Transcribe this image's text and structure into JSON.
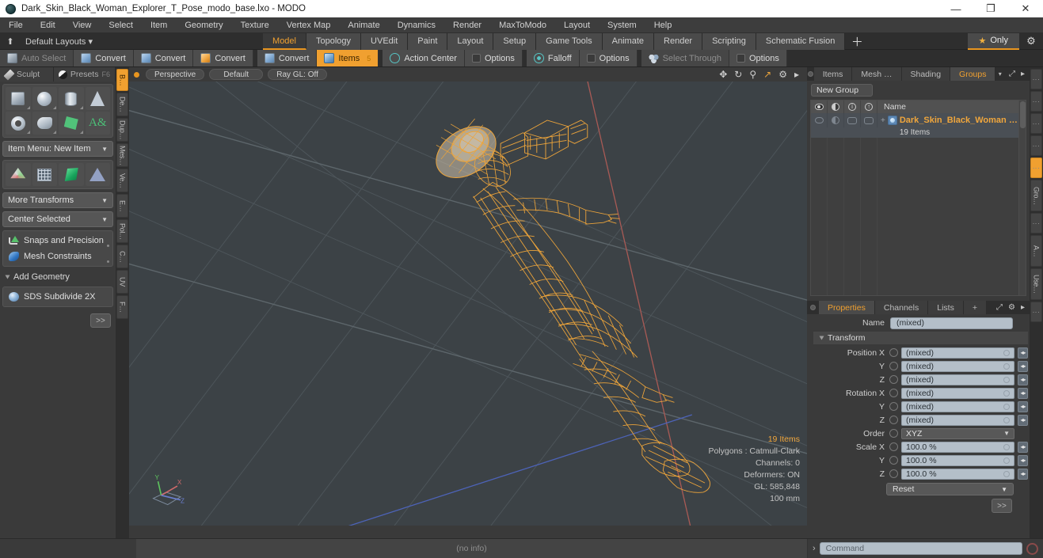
{
  "window": {
    "title": "Dark_Skin_Black_Woman_Explorer_T_Pose_modo_base.lxo - MODO",
    "minimize": "—",
    "maximize": "❐",
    "close": "✕"
  },
  "menu": {
    "items": [
      "File",
      "Edit",
      "View",
      "Select",
      "Item",
      "Geometry",
      "Texture",
      "Vertex Map",
      "Animate",
      "Dynamics",
      "Render",
      "MaxToModo",
      "Layout",
      "System",
      "Help"
    ]
  },
  "layoutbar": {
    "home_icon": "⬆",
    "layouts_label": "Default Layouts",
    "caret": "▾",
    "tabs": [
      {
        "label": "Model",
        "active": true
      },
      {
        "label": "Topology",
        "active": false
      },
      {
        "label": "UVEdit",
        "active": false
      },
      {
        "label": "Paint",
        "active": false
      },
      {
        "label": "Layout",
        "active": false
      },
      {
        "label": "Setup",
        "active": false
      },
      {
        "label": "Game Tools",
        "active": false
      },
      {
        "label": "Animate",
        "active": false
      },
      {
        "label": "Render",
        "active": false
      },
      {
        "label": "Scripting",
        "active": false
      },
      {
        "label": "Schematic Fusion",
        "active": false
      }
    ],
    "plus": "＋",
    "only_label": "Only",
    "star": "★",
    "gear": "⚙"
  },
  "modebar": {
    "auto_select": "Auto Select",
    "convert_1": "Convert",
    "convert_2": "Convert",
    "convert_3": "Convert",
    "convert_4": "Convert",
    "items": "Items",
    "items_badge": "5",
    "action_center": "Action Center",
    "options_1": "Options",
    "falloff": "Falloff",
    "options_2": "Options",
    "select_through": "Select Through",
    "options_3": "Options"
  },
  "left_panel": {
    "tabs": [
      {
        "label": "Sculpt",
        "shortcut": ""
      },
      {
        "label": "Presets",
        "shortcut": "F6"
      }
    ],
    "primitives": [
      {
        "name": "cube"
      },
      {
        "name": "sphere"
      },
      {
        "name": "cylinder"
      },
      {
        "name": "cone"
      },
      {
        "name": "torus"
      },
      {
        "name": "teapot"
      },
      {
        "name": "polygon"
      },
      {
        "name": "text"
      }
    ],
    "item_menu": "Item Menu: New Item",
    "tool_row": [
      {
        "name": "joint"
      },
      {
        "name": "grid"
      },
      {
        "name": "gem"
      },
      {
        "name": "pyramid"
      }
    ],
    "more_transforms": "More Transforms",
    "center_selected": "Center Selected",
    "snaps_and_precision": "Snaps and Precision",
    "mesh_constraints": "Mesh Constraints",
    "add_geometry": "Add Geometry",
    "sds_subdivide": "SDS Subdivide 2X",
    "expand_button": ">>"
  },
  "left_vtabs": [
    "B…",
    "De…",
    "Dup…",
    "Mes…",
    "Ve…",
    "E…",
    "Pol…",
    "C…",
    "UV",
    "F…"
  ],
  "viewport": {
    "perspective": "Perspective",
    "shading": "Default",
    "raygl": "Ray GL: Off",
    "icons": [
      "move-icon",
      "rotate-icon",
      "zoom-icon",
      "fit-icon",
      "gear-icon",
      "more-icon"
    ],
    "stats": {
      "items": "19 Items",
      "polygons": "Polygons : Catmull-Clark",
      "channels": "Channels: 0",
      "deformers": "Deformers: ON",
      "gl": "GL: 585,848",
      "scale": "100 mm"
    },
    "axis_labels": [
      "Y",
      "X",
      "Z"
    ]
  },
  "right_panel": {
    "tabs": [
      {
        "label": "Items",
        "active": false
      },
      {
        "label": "Mesh …",
        "active": false
      },
      {
        "label": "Shading",
        "active": false
      },
      {
        "label": "Groups",
        "active": true
      }
    ],
    "tab_caret": "▾",
    "expand_icon": "⤢",
    "more_icon": "▸",
    "new_group": "New Group",
    "tree_header": {
      "col_name": "Name",
      "icons": [
        "eye-icon",
        "shading-icon",
        "info-icon",
        "lock-icon"
      ]
    },
    "tree_rows": [
      {
        "name": "Dark_Skin_Black_Woman …",
        "sub": "19 Items",
        "expand": "+"
      }
    ]
  },
  "right_vtabs": [
    "⋮",
    "⋮",
    "⋮",
    "⋮",
    "⋮",
    "Gro…",
    "⋮",
    "A…",
    "Use…",
    "⋮"
  ],
  "properties": {
    "tabs": [
      {
        "label": "Properties",
        "active": true
      },
      {
        "label": "Channels",
        "active": false
      },
      {
        "label": "Lists",
        "active": false
      },
      {
        "label": "+",
        "active": false
      }
    ],
    "expand_icon": "⤢",
    "gear_icon": "⚙",
    "more_icon": "▸",
    "name_label": "Name",
    "name_value": "(mixed)",
    "transform_label": "Transform",
    "rows": [
      {
        "label": "Position X",
        "value": "(mixed)",
        "type": "field"
      },
      {
        "label": "Y",
        "value": "(mixed)",
        "type": "field"
      },
      {
        "label": "Z",
        "value": "(mixed)",
        "type": "field"
      },
      {
        "label": "Rotation X",
        "value": "(mixed)",
        "type": "field"
      },
      {
        "label": "Y",
        "value": "(mixed)",
        "type": "field"
      },
      {
        "label": "Z",
        "value": "(mixed)",
        "type": "field"
      },
      {
        "label": "Order",
        "value": "XYZ",
        "type": "dropdown"
      },
      {
        "label": "Scale X",
        "value": "100.0 %",
        "type": "field"
      },
      {
        "label": "Y",
        "value": "100.0 %",
        "type": "field"
      },
      {
        "label": "Z",
        "value": "100.0 %",
        "type": "field"
      }
    ],
    "reset_label": "Reset",
    "expand_button": ">>"
  },
  "statusbar": {
    "info": "(no info)",
    "prompt": "›",
    "command_placeholder": "Command"
  },
  "colors": {
    "accent_orange": "#f0a030",
    "wireframe_orange": "#f5a93a",
    "panel_bg": "#3a3a3a",
    "viewport_bg": "#3c4246",
    "axis_x": "#b55a5a",
    "axis_z": "#4a63b5",
    "field_bg": "#b4bfc9"
  }
}
